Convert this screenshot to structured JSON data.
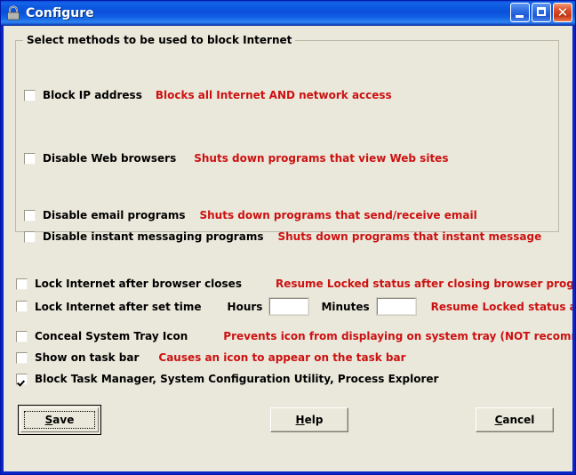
{
  "window": {
    "title": "Configure",
    "icon": "padlock-icon",
    "accent_blue": "#0A24C8",
    "client_background": "#EAE8DB",
    "hint_color": "#CC1111",
    "buttons": {
      "minimize": "minimize-icon",
      "maximize": "maximize-icon",
      "close": "✕"
    }
  },
  "groupbox": {
    "legend": "Select methods to be used to block Internet",
    "options": [
      {
        "label": "Block IP address",
        "hint": "Blocks all Internet AND network access",
        "checked": false
      },
      {
        "label": "Disable Web browsers",
        "hint": "Shuts down programs that view Web sites",
        "checked": false
      },
      {
        "label": "Disable email programs",
        "hint": "Shuts down programs that send/receive email",
        "checked": false
      },
      {
        "label": "Disable instant messaging programs",
        "hint": "Shuts down programs that instant message",
        "checked": false
      }
    ]
  },
  "options": [
    {
      "label": "Lock Internet after browser closes",
      "hint": "Resume Locked status after closing browser programs",
      "checked": false
    },
    {
      "label": "Lock Internet after set time",
      "hint": "Resume Locked status after set time",
      "checked": false
    },
    {
      "label": "Conceal System Tray Icon",
      "hint": "Prevents icon from displaying on system tray (NOT recommended)",
      "checked": false
    },
    {
      "label": "Show on task bar",
      "hint": "Causes an icon to appear on the task bar",
      "checked": false
    },
    {
      "label": "Block Task Manager, System Configuration Utility, Process Explorer",
      "hint": "",
      "checked": true
    }
  ],
  "time": {
    "hours_label": "Hours",
    "hours_value": "",
    "hours_placeholder": "",
    "minutes_label": "Minutes",
    "minutes_value": "",
    "minutes_placeholder": ""
  },
  "actions": {
    "save": {
      "accel": "S",
      "rest": "ave",
      "default": true
    },
    "help": {
      "accel": "H",
      "rest": "elp",
      "default": false
    },
    "cancel": {
      "accel": "C",
      "rest": "ancel",
      "default": false
    }
  }
}
